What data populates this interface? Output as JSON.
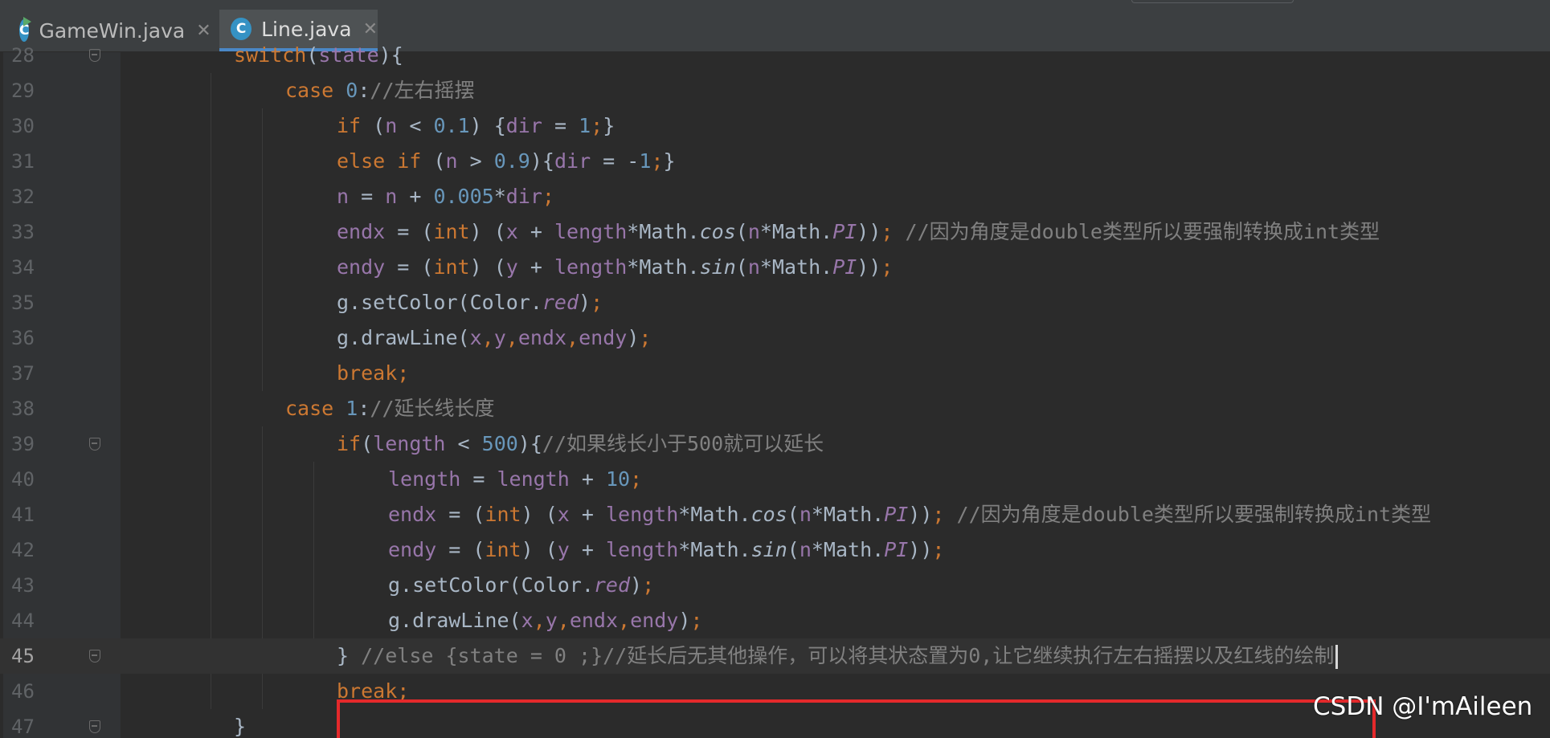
{
  "tabs": [
    {
      "label": "GameWin.java",
      "icon": "java-class-run-icon",
      "active": false
    },
    {
      "label": "Line.java",
      "icon": "java-class-icon",
      "active": true
    }
  ],
  "tab_icon_letter": "C",
  "tab_close_glyph": "✕",
  "lines": [
    {
      "n": "28",
      "indent": 2,
      "fold": true,
      "tokens": [
        [
          "kw",
          "switch"
        ],
        [
          "pl",
          "("
        ],
        [
          "fld",
          "state"
        ],
        [
          "pl",
          "){"
        ]
      ]
    },
    {
      "n": "29",
      "indent": 3,
      "tokens": [
        [
          "kw",
          "case "
        ],
        [
          "num",
          "0"
        ],
        [
          "pl",
          ":"
        ],
        [
          "cmt",
          "//左右摇摆"
        ]
      ]
    },
    {
      "n": "30",
      "indent": 4,
      "tokens": [
        [
          "kw",
          "if "
        ],
        [
          "pl",
          "("
        ],
        [
          "fld",
          "n"
        ],
        [
          "pl",
          " < "
        ],
        [
          "num",
          "0.1"
        ],
        [
          "pl",
          ") {"
        ],
        [
          "fld",
          "dir"
        ],
        [
          "pl",
          " = "
        ],
        [
          "num",
          "1"
        ],
        [
          "kw",
          ";"
        ],
        [
          "pl",
          "}"
        ]
      ]
    },
    {
      "n": "31",
      "indent": 4,
      "tokens": [
        [
          "kw",
          "else if "
        ],
        [
          "pl",
          "("
        ],
        [
          "fld",
          "n"
        ],
        [
          "pl",
          " > "
        ],
        [
          "num",
          "0.9"
        ],
        [
          "pl",
          "){"
        ],
        [
          "fld",
          "dir"
        ],
        [
          "pl",
          " = -"
        ],
        [
          "num",
          "1"
        ],
        [
          "kw",
          ";"
        ],
        [
          "pl",
          "}"
        ]
      ]
    },
    {
      "n": "32",
      "indent": 4,
      "tokens": [
        [
          "fld",
          "n"
        ],
        [
          "pl",
          " = "
        ],
        [
          "fld",
          "n"
        ],
        [
          "pl",
          " + "
        ],
        [
          "num",
          "0.005"
        ],
        [
          "pl",
          "*"
        ],
        [
          "fld",
          "dir"
        ],
        [
          "kw",
          ";"
        ]
      ]
    },
    {
      "n": "33",
      "indent": 4,
      "tokens": [
        [
          "fld",
          "endx"
        ],
        [
          "pl",
          " = ("
        ],
        [
          "kw",
          "int"
        ],
        [
          "pl",
          ") ("
        ],
        [
          "fld",
          "x"
        ],
        [
          "pl",
          " + "
        ],
        [
          "fld",
          "length"
        ],
        [
          "pl",
          "*Math."
        ],
        [
          "mth",
          "cos"
        ],
        [
          "pl",
          "("
        ],
        [
          "fld",
          "n"
        ],
        [
          "pl",
          "*Math."
        ],
        [
          "ifld",
          "PI"
        ],
        [
          "pl",
          "))"
        ],
        [
          "kw",
          "; "
        ],
        [
          "cmt",
          "//因为角度是double类型所以要强制转换成int类型"
        ]
      ]
    },
    {
      "n": "34",
      "indent": 4,
      "tokens": [
        [
          "fld",
          "endy"
        ],
        [
          "pl",
          " = ("
        ],
        [
          "kw",
          "int"
        ],
        [
          "pl",
          ") ("
        ],
        [
          "fld",
          "y"
        ],
        [
          "pl",
          " + "
        ],
        [
          "fld",
          "length"
        ],
        [
          "pl",
          "*Math."
        ],
        [
          "mth",
          "sin"
        ],
        [
          "pl",
          "("
        ],
        [
          "fld",
          "n"
        ],
        [
          "pl",
          "*Math."
        ],
        [
          "ifld",
          "PI"
        ],
        [
          "pl",
          "))"
        ],
        [
          "kw",
          ";"
        ]
      ]
    },
    {
      "n": "35",
      "indent": 4,
      "tokens": [
        [
          "pl",
          "g.setColor(Color."
        ],
        [
          "ifld",
          "red"
        ],
        [
          "pl",
          ")"
        ],
        [
          "kw",
          ";"
        ]
      ]
    },
    {
      "n": "36",
      "indent": 4,
      "tokens": [
        [
          "pl",
          "g.drawLine("
        ],
        [
          "fld",
          "x"
        ],
        [
          "kw",
          ","
        ],
        [
          "fld",
          "y"
        ],
        [
          "kw",
          ","
        ],
        [
          "fld",
          "endx"
        ],
        [
          "kw",
          ","
        ],
        [
          "fld",
          "endy"
        ],
        [
          "pl",
          ")"
        ],
        [
          "kw",
          ";"
        ]
      ]
    },
    {
      "n": "37",
      "indent": 4,
      "tokens": [
        [
          "kw",
          "break;"
        ]
      ]
    },
    {
      "n": "38",
      "indent": 3,
      "tokens": [
        [
          "kw",
          "case "
        ],
        [
          "num",
          "1"
        ],
        [
          "pl",
          ":"
        ],
        [
          "cmt",
          "//延长线长度"
        ]
      ]
    },
    {
      "n": "39",
      "indent": 4,
      "fold": true,
      "tokens": [
        [
          "kw",
          "if"
        ],
        [
          "pl",
          "("
        ],
        [
          "fld",
          "length"
        ],
        [
          "pl",
          " < "
        ],
        [
          "num",
          "500"
        ],
        [
          "pl",
          "){"
        ],
        [
          "cmt",
          "//如果线长小于500就可以延长"
        ]
      ]
    },
    {
      "n": "40",
      "indent": 5,
      "tokens": [
        [
          "fld",
          "length"
        ],
        [
          "pl",
          " = "
        ],
        [
          "fld",
          "length"
        ],
        [
          "pl",
          " + "
        ],
        [
          "num",
          "10"
        ],
        [
          "kw",
          ";"
        ]
      ]
    },
    {
      "n": "41",
      "indent": 5,
      "tokens": [
        [
          "fld",
          "endx"
        ],
        [
          "pl",
          " = ("
        ],
        [
          "kw",
          "int"
        ],
        [
          "pl",
          ") ("
        ],
        [
          "fld",
          "x"
        ],
        [
          "pl",
          " + "
        ],
        [
          "fld",
          "length"
        ],
        [
          "pl",
          "*Math."
        ],
        [
          "mth",
          "cos"
        ],
        [
          "pl",
          "("
        ],
        [
          "fld",
          "n"
        ],
        [
          "pl",
          "*Math."
        ],
        [
          "ifld",
          "PI"
        ],
        [
          "pl",
          "))"
        ],
        [
          "kw",
          "; "
        ],
        [
          "cmt",
          "//因为角度是double类型所以要强制转换成int类型"
        ]
      ]
    },
    {
      "n": "42",
      "indent": 5,
      "tokens": [
        [
          "fld",
          "endy"
        ],
        [
          "pl",
          " = ("
        ],
        [
          "kw",
          "int"
        ],
        [
          "pl",
          ") ("
        ],
        [
          "fld",
          "y"
        ],
        [
          "pl",
          " + "
        ],
        [
          "fld",
          "length"
        ],
        [
          "pl",
          "*Math."
        ],
        [
          "mth",
          "sin"
        ],
        [
          "pl",
          "("
        ],
        [
          "fld",
          "n"
        ],
        [
          "pl",
          "*Math."
        ],
        [
          "ifld",
          "PI"
        ],
        [
          "pl",
          "))"
        ],
        [
          "kw",
          ";"
        ]
      ]
    },
    {
      "n": "43",
      "indent": 5,
      "tokens": [
        [
          "pl",
          "g.setColor(Color."
        ],
        [
          "ifld",
          "red"
        ],
        [
          "pl",
          ")"
        ],
        [
          "kw",
          ";"
        ]
      ]
    },
    {
      "n": "44",
      "indent": 5,
      "tokens": [
        [
          "pl",
          "g.drawLine("
        ],
        [
          "fld",
          "x"
        ],
        [
          "kw",
          ","
        ],
        [
          "fld",
          "y"
        ],
        [
          "kw",
          ","
        ],
        [
          "fld",
          "endx"
        ],
        [
          "kw",
          ","
        ],
        [
          "fld",
          "endy"
        ],
        [
          "pl",
          ")"
        ],
        [
          "kw",
          ";"
        ]
      ]
    },
    {
      "n": "45",
      "indent": 4,
      "fold": true,
      "current": true,
      "tokens": [
        [
          "pl",
          "} "
        ],
        [
          "cmt",
          "//else {state = 0 ;}//延长后无其他操作，可以将其状态置为0,让它继续执行左右摇摆以及红线的绘制"
        ]
      ]
    },
    {
      "n": "46",
      "indent": 4,
      "tokens": [
        [
          "kw",
          "break;"
        ]
      ]
    },
    {
      "n": "47",
      "indent": 2,
      "fold": true,
      "tokens": [
        [
          "pl",
          "}"
        ]
      ]
    }
  ],
  "watermark": "CSDN @I'mAileen",
  "colors": {
    "keyword": "#cc7832",
    "number": "#6897bb",
    "field": "#9876aa",
    "comment": "#808080",
    "plain": "#a9b7c6",
    "highlight_box": "#e4292b"
  }
}
